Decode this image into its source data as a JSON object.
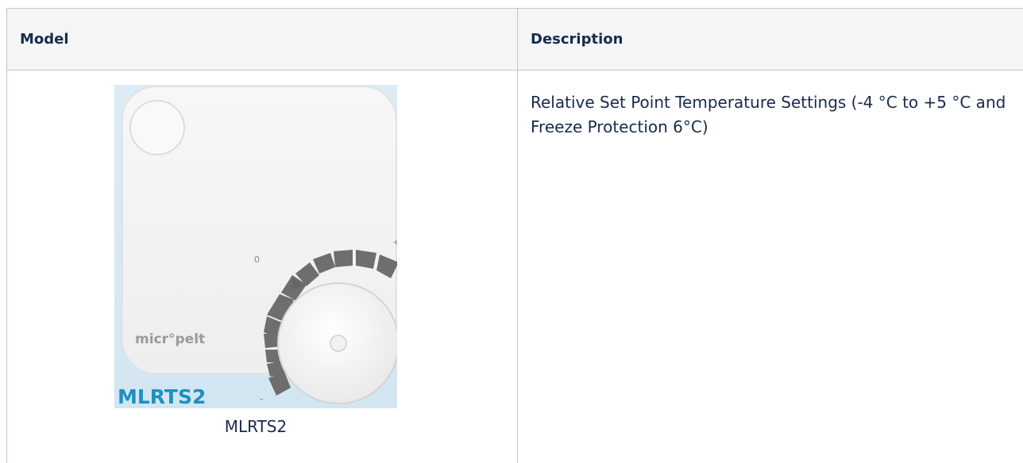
{
  "table": {
    "headers": {
      "model": "Model",
      "description": "Description"
    },
    "rows": [
      {
        "image": {
          "brand": "micr°pelt",
          "product_label": "MLRTS2",
          "dial_labels": {
            "zero": "0",
            "plus": "+",
            "minus": "-"
          }
        },
        "caption": "MLRTS2",
        "description": "Relative Set Point Temperature Settings (-4 °C to +5 °C and Freeze Protection 6°C)"
      }
    ]
  },
  "colors": {
    "header_bg": "#f4f5f7",
    "border": "#c1c7d0",
    "text": "#172b4d",
    "label_blue": "#1f8fc2",
    "dial_grey": "#6e6e6e"
  }
}
